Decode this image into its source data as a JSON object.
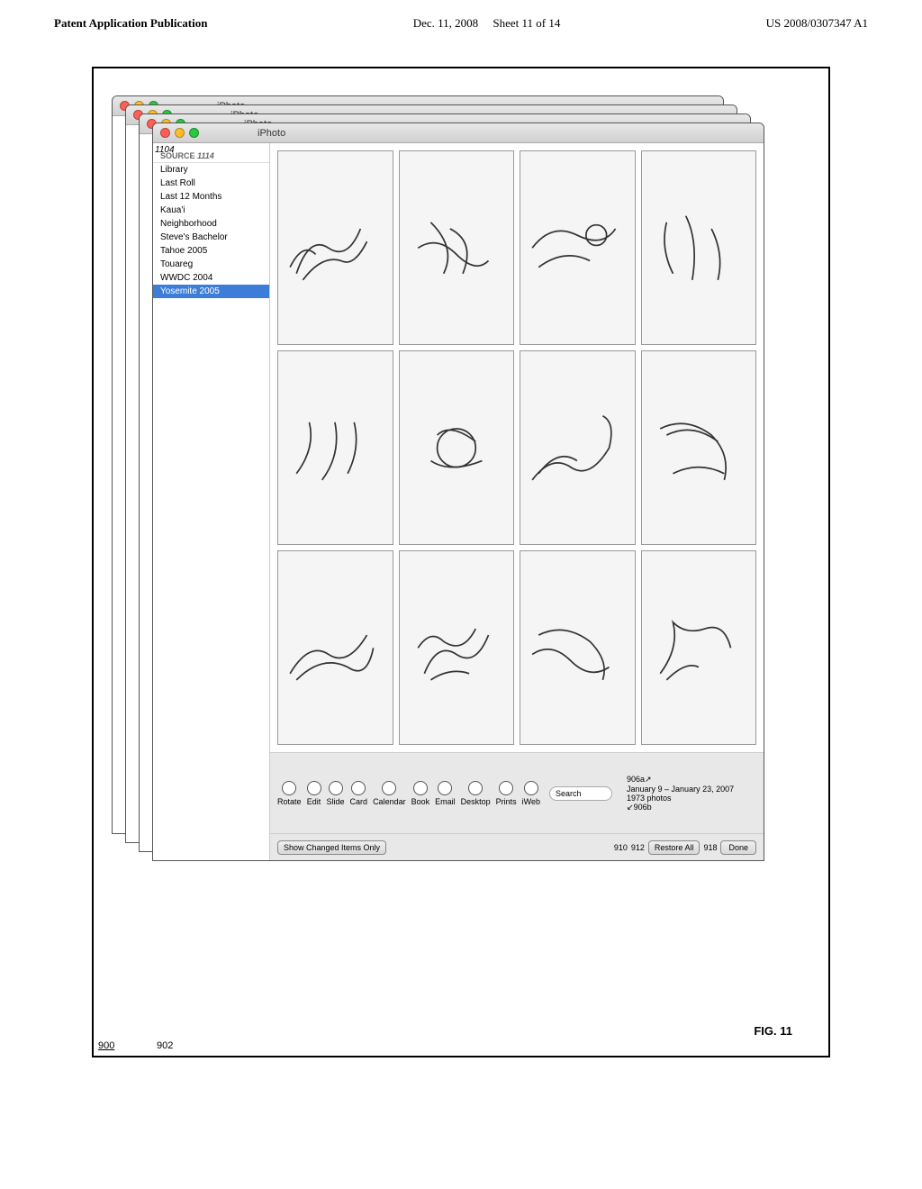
{
  "header": {
    "left": "Patent Application Publication",
    "center": "Dec. 11, 2008",
    "sheet": "Sheet 11 of 14",
    "right": "US 2008/0307347 A1"
  },
  "figure": {
    "label": "FIG. 11",
    "number": "900"
  },
  "windows": [
    {
      "title": "iPhoto"
    },
    {
      "title": "iPhoto"
    },
    {
      "title": "iPhoto"
    },
    {
      "title": "iPhoto"
    }
  ],
  "sidebar": {
    "section_label": "Source",
    "section_ref": "1114",
    "items": [
      {
        "label": "Library",
        "selected": false
      },
      {
        "label": "Last Roll",
        "selected": false
      },
      {
        "label": "Last 12 Months",
        "selected": false
      },
      {
        "label": "Kaua'i",
        "selected": false
      },
      {
        "label": "Neighborhood",
        "selected": false
      },
      {
        "label": "Steve's Bachelor",
        "selected": false
      },
      {
        "label": "Tahoe 2005",
        "selected": false
      },
      {
        "label": "Touareg",
        "selected": false
      },
      {
        "label": "WWDC 2004",
        "selected": false
      },
      {
        "label": "Yosemite 2005",
        "selected": true
      }
    ]
  },
  "info": {
    "date_range": "January 9 – January 23, 2007",
    "count": "1973 photos",
    "ref_906a": "906a",
    "ref_906b": "906b"
  },
  "toolbar": {
    "buttons": [
      {
        "label": "Rotate"
      },
      {
        "label": "Edit"
      },
      {
        "label": "Slide"
      },
      {
        "label": "Card"
      },
      {
        "label": "Calendar"
      },
      {
        "label": "Book"
      },
      {
        "label": "Email"
      },
      {
        "label": "Desktop"
      },
      {
        "label": "Prints"
      },
      {
        "label": "iWeb"
      }
    ],
    "search_placeholder": "Search",
    "restore_label": "Restore All",
    "show_changed_label": "Show Changed Items Only",
    "done_label": "Done"
  },
  "refs": {
    "r900": "900",
    "r902": "902",
    "r910": "910",
    "r912": "912",
    "r918": "918",
    "r1104": "1104",
    "r1114": "1114",
    "r906a": "906a",
    "r906b": "906b"
  }
}
